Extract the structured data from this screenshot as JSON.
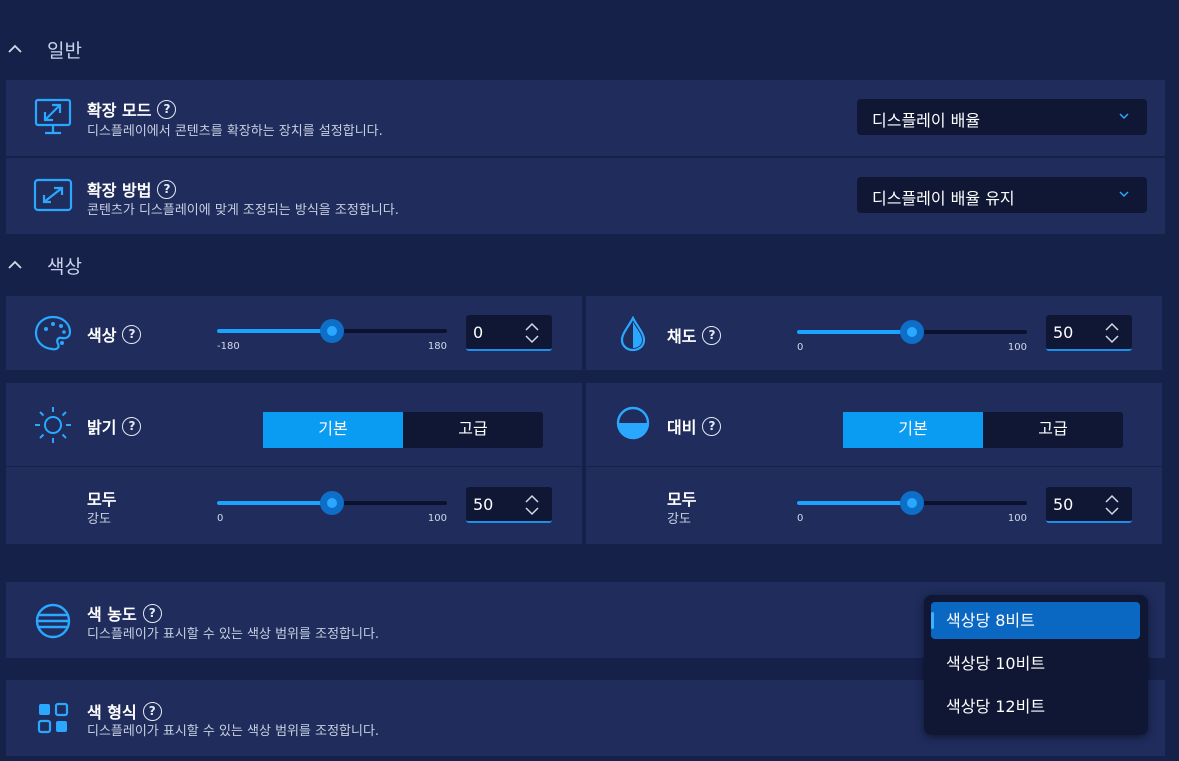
{
  "sections": {
    "general": {
      "title": "일반"
    },
    "color": {
      "title": "색상"
    }
  },
  "scale_mode": {
    "title": "확장 모드",
    "help": "?",
    "desc": "디스플레이에서 콘텐츠를 확장하는 장치를 설정합니다.",
    "value": "디스플레이 배율",
    "icon": "monitor-expand-icon"
  },
  "scale_method": {
    "title": "확장 방법",
    "help": "?",
    "desc": "콘텐츠가 디스플레이에 맞게 조정되는 방식을 조정합니다.",
    "value": "디스플레이 배율 유지",
    "icon": "expand-arrows-icon"
  },
  "hue": {
    "title": "색상",
    "help": "?",
    "value": "0",
    "min_label": "-180",
    "max_label": "180",
    "level": 0.5,
    "icon": "palette-icon"
  },
  "saturation": {
    "title": "채도",
    "help": "?",
    "value": "50",
    "min_label": "0",
    "max_label": "100",
    "level": 0.5,
    "icon": "droplet-icon"
  },
  "brightness": {
    "title": "밝기",
    "help": "?",
    "mode_basic": "기본",
    "mode_advanced": "고급",
    "sub_title": "모두",
    "sub_desc": "강도",
    "value": "50",
    "min_label": "0",
    "max_label": "100",
    "level": 0.5,
    "icon": "sun-icon"
  },
  "contrast": {
    "title": "대비",
    "help": "?",
    "mode_basic": "기본",
    "mode_advanced": "고급",
    "sub_title": "모두",
    "sub_desc": "강도",
    "value": "50",
    "min_label": "0",
    "max_label": "100",
    "level": 0.5,
    "icon": "contrast-circle-icon"
  },
  "color_depth": {
    "title": "색 농도",
    "help": "?",
    "desc": "디스플레이가 표시할 수 있는 색상 범위를 조정합니다.",
    "icon": "striped-globe-icon",
    "options": [
      "색상당 8비트",
      "색상당 10비트",
      "색상당 12비트"
    ],
    "selected": "색상당 8비트"
  },
  "color_format": {
    "title": "색 형식",
    "help": "?",
    "desc": "디스플레이가 표시할 수 있는 색상 범위를 조정합니다.",
    "icon": "grid-squares-icon"
  },
  "colors": {
    "accent": "#0a9bf2",
    "card": "#1f2c5c",
    "background": "#16214a",
    "input": "#0f1734"
  }
}
